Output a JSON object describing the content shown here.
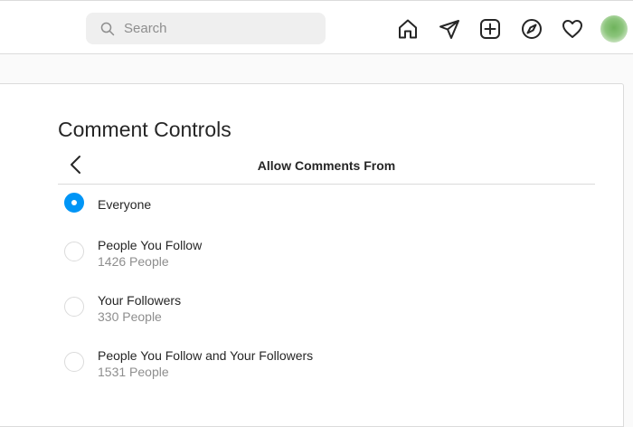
{
  "header": {
    "search": {
      "placeholder": "Search",
      "value": ""
    },
    "nav_icons": [
      "home-icon",
      "direct-icon",
      "new-post-icon",
      "explore-icon",
      "activity-icon",
      "avatar"
    ]
  },
  "settings": {
    "title": "Comment Controls",
    "subtitle": "Allow Comments From",
    "options": [
      {
        "label": "Everyone",
        "count": "",
        "selected": true
      },
      {
        "label": "People You Follow",
        "count": "1426 People",
        "selected": false
      },
      {
        "label": "Your Followers",
        "count": "330 People",
        "selected": false
      },
      {
        "label": "People You Follow and Your Followers",
        "count": "1531 People",
        "selected": false
      }
    ]
  },
  "colors": {
    "accent": "#0095f6",
    "border": "#dbdbdb",
    "secondary_text": "#8e8e8e"
  }
}
